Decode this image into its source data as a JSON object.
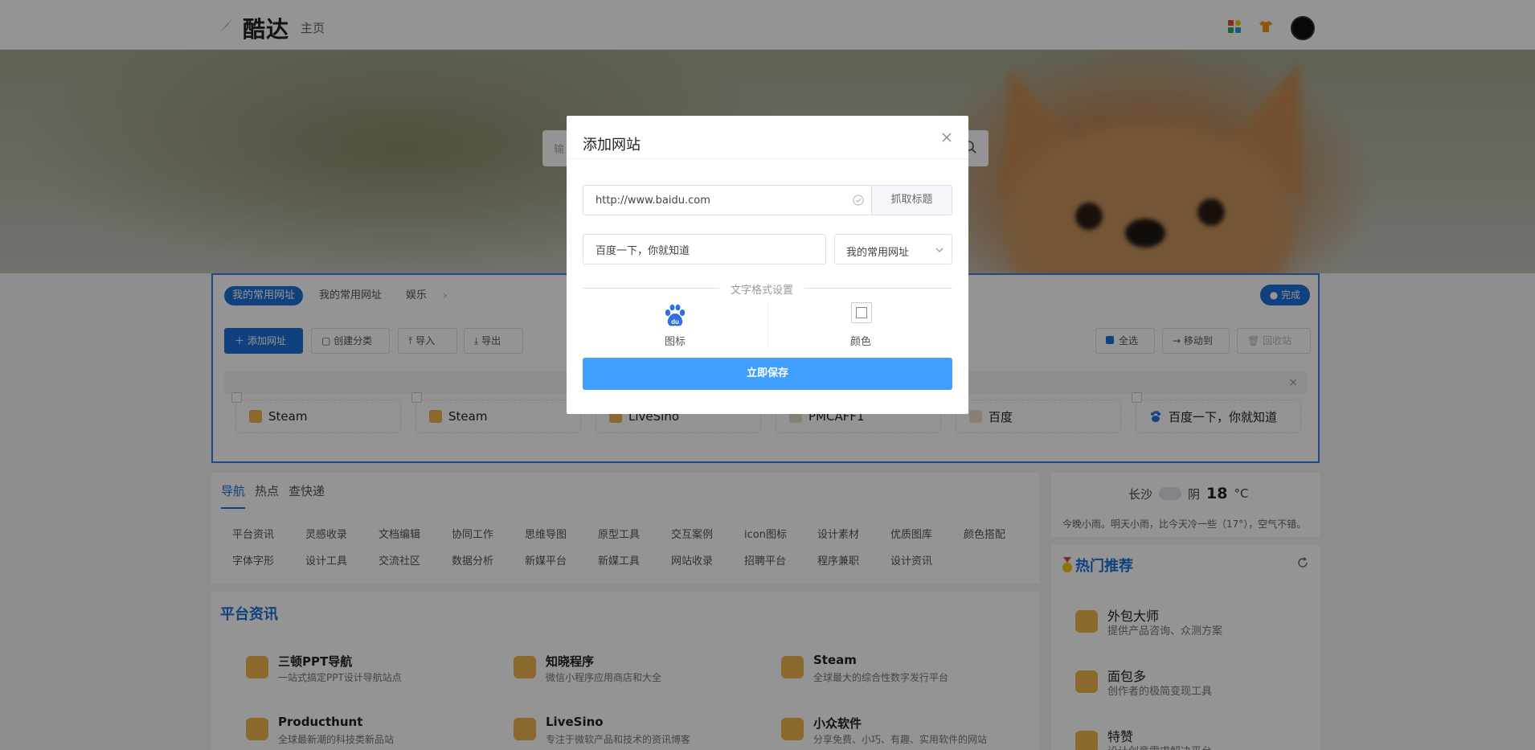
{
  "header": {
    "logo_text": "酷达",
    "home_label": "主页"
  },
  "hero": {
    "search_placeholder": "输"
  },
  "quick_panel": {
    "tabs": [
      "我的常用网址",
      "我的常用网址",
      "娱乐"
    ],
    "done_label": "完成",
    "toolbar": {
      "add_site": "添加网址",
      "create_category": "创建分类",
      "import": "导入",
      "export": "导出",
      "select_all": "全选",
      "move_to": "移动到",
      "recycle_bin": "回收站"
    },
    "sites": [
      {
        "name": "Steam",
        "icon": "raccoon-icon"
      },
      {
        "name": "Steam",
        "icon": "raccoon-icon"
      },
      {
        "name": "LiveSino",
        "icon": "raccoon-icon"
      },
      {
        "name": "PMCAFF1",
        "icon": "placeholder-icon"
      },
      {
        "name": "百度",
        "icon": "placeholder-icon"
      },
      {
        "name": "百度一下，你就知道",
        "icon": "baidu-paw-icon"
      }
    ]
  },
  "nav": {
    "tabs": [
      "导航",
      "热点",
      "查快递"
    ],
    "categories": [
      "平台资讯",
      "灵感收录",
      "文档编辑",
      "协同工作",
      "思维导图",
      "原型工具",
      "交互案例",
      "icon图标",
      "设计素材",
      "优质图库",
      "颜色搭配",
      "字体字形",
      "设计工具",
      "交流社区",
      "数据分析",
      "新媒平台",
      "新媒工具",
      "网站收录",
      "招聘平台",
      "程序兼职",
      "设计资讯"
    ]
  },
  "platform_news": {
    "title": "平台资讯",
    "items": [
      {
        "name": "三顿PPT导航",
        "desc": "一站式搞定PPT设计导航站点"
      },
      {
        "name": "知晓程序",
        "desc": "微信小程序应用商店和大全"
      },
      {
        "name": "Steam",
        "desc": "全球最大的综合性数字发行平台"
      },
      {
        "name": "Producthunt",
        "desc": "全球最新潮的科技类新品站"
      },
      {
        "name": "LiveSino",
        "desc": "专注于微软产品和技术的资讯博客"
      },
      {
        "name": "小众软件",
        "desc": "分享免费、小巧、有趣、实用软件的网站"
      }
    ]
  },
  "weather": {
    "city": "长沙",
    "condition": "阴",
    "temperature": "18",
    "unit": "°C",
    "forecast": "今晚小雨。明天小雨，比今天冷一些（17°），空气不错。"
  },
  "hot": {
    "title": "热门推荐",
    "items": [
      {
        "name": "外包大师",
        "desc": "提供产品咨询、众测方案"
      },
      {
        "name": "面包多",
        "desc": "创作者的极简变现工具"
      },
      {
        "name": "特赞",
        "desc": "设计创意需求解决平台"
      }
    ]
  },
  "modal": {
    "title": "添加网站",
    "url_value": "http://www.baidu.com",
    "fetch_title_label": "抓取标题",
    "title_value": "百度一下，你就知道",
    "category_value": "我的常用网址",
    "format_label": "文字格式设置",
    "icon_option_label": "图标",
    "color_option_label": "颜色",
    "save_label": "立即保存"
  },
  "colors": {
    "primary": "#1e6fd9",
    "save_button": "#409eff",
    "overlay": "rgba(0,0,0,0.42)"
  }
}
